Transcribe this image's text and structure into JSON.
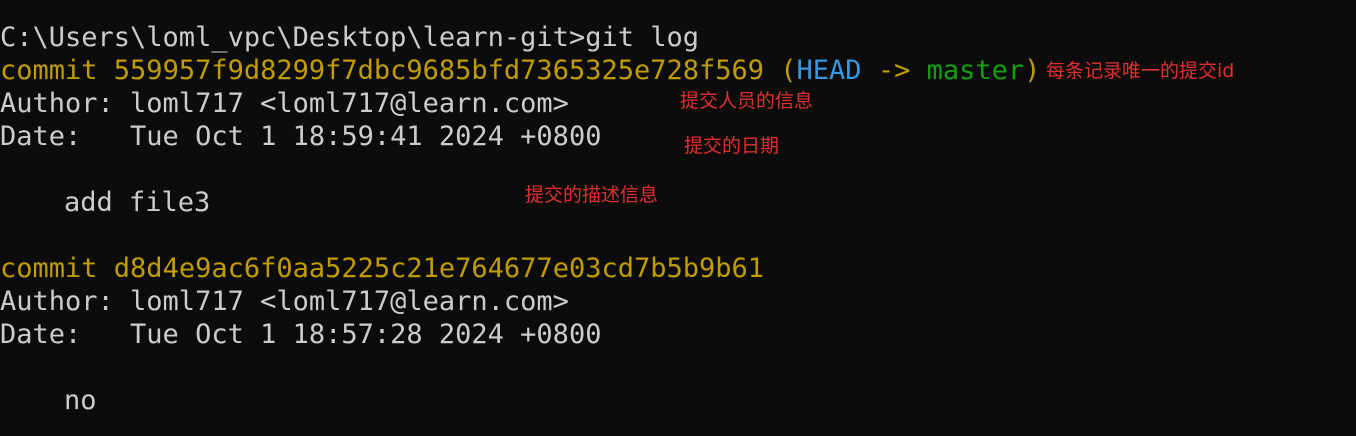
{
  "terminal": {
    "prompt": "C:\\Users\\loml_vpc\\Desktop\\learn-git>git log",
    "commits": [
      {
        "commit_prefix": "commit ",
        "hash": "559957f9d8299f7dbc9685bfd7365325e728f569",
        "ref_open": " (",
        "head": "HEAD",
        "arrow": " -> ",
        "branch": "master",
        "ref_close": ")",
        "author": "Author: loml717 <loml717@learn.com>",
        "date": "Date:   Tue Oct 1 18:59:41 2024 +0800",
        "message": "add file3"
      },
      {
        "commit_prefix": "commit ",
        "hash": "d8d4e9ac6f0aa5225c21e764677e03cd7b5b9b61",
        "author": "Author: loml717 <loml717@learn.com>",
        "date": "Date:   Tue Oct 1 18:57:28 2024 +0800",
        "message": "no"
      }
    ]
  },
  "annotations": {
    "commit_id": "每条记录唯一的提交id",
    "author_info": "提交人员的信息",
    "date_info": "提交的日期",
    "message_info": "提交的描述信息"
  },
  "colors": {
    "background": "#0c0c0c",
    "text": "#cccccc",
    "commit": "#c19c00",
    "head": "#3a96dd",
    "branch": "#13a10e",
    "annotation": "#e23030"
  }
}
